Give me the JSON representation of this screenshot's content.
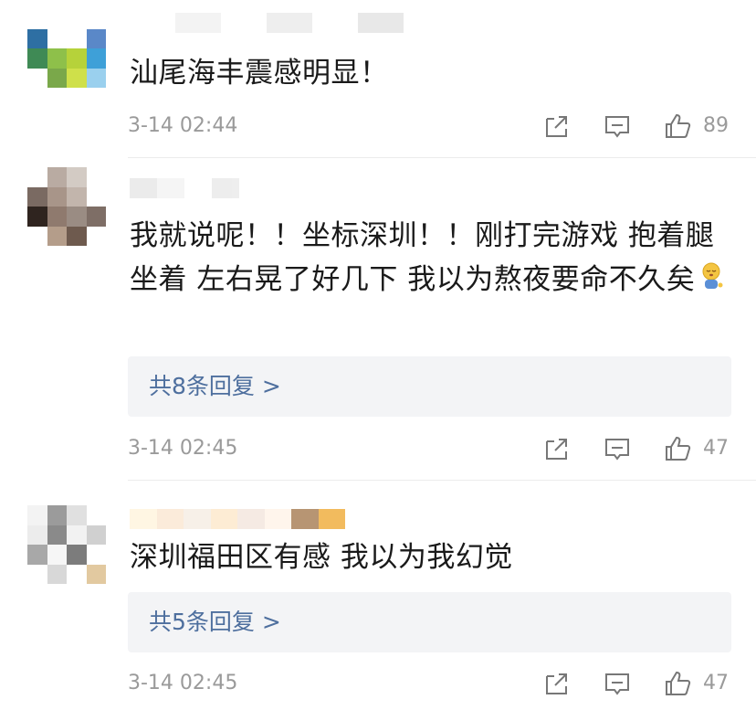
{
  "comments": [
    {
      "text": "汕尾海丰震感明显！",
      "time": "3-14 02:44",
      "likes": "89",
      "avatar_colors": [
        "#ffffff",
        "#ffffff",
        "#ffffff",
        "#ffffff",
        "#2e6fa3",
        "#ffffff",
        "#ffffff",
        "#5a88c8",
        "#3f8a55",
        "#8ec04a",
        "#b6d23a",
        "#3ea0d8",
        "#ffffff",
        "#7aa84a",
        "#cfe04a",
        "#9ad0ee"
      ],
      "username_colors": [
        "#ffffff",
        "#f2f2f2",
        "#ffffff",
        "#ededed",
        "#ffffff",
        "#e6e6e6"
      ]
    },
    {
      "text": "我就说呢！！坐标深圳！！刚打完游戏 抱着腿坐着 左右晃了好几下 我以为熬夜要命不久矣",
      "replies": "共8条回复 >",
      "time": "3-14 02:45",
      "likes": "47",
      "avatar_colors": [
        "#ffffff",
        "#b9aba2",
        "#d3cbc4",
        "#ffffff",
        "#7a6a62",
        "#a89589",
        "#c2b5ac",
        "#ffffff",
        "#2f241f",
        "#8f7a6e",
        "#9a8c83",
        "#7e6e66",
        "#ffffff",
        "#b49d8a",
        "#6e5a4e",
        "#ffffff"
      ],
      "username_colors": [
        "#e9e9e9",
        "#f4f4f4",
        "#ffffff",
        "#ececec"
      ]
    },
    {
      "text": "深圳福田区有感 我以为我幻觉",
      "replies": "共5条回复 >",
      "time": "3-14 02:45",
      "likes": "47",
      "avatar_colors": [
        "#f3f3f3",
        "#9b9b9b",
        "#e0e0e0",
        "#ffffff",
        "#ececec",
        "#8a8a8a",
        "#f2f2f2",
        "#d0d0d0",
        "#a8a8a8",
        "#f6f6f6",
        "#7c7c7c",
        "#ffffff",
        "#ffffff",
        "#d8d8d8",
        "#ffffff",
        "#e2c9a0"
      ],
      "username_colors": [
        "#fff6e0",
        "#fbe9d6",
        "#f7efe6",
        "#fdebd0",
        "#f4e8e0",
        "#fff4ea",
        "#b08a64",
        "#f1b44d"
      ]
    }
  ],
  "icons": {
    "share": "share-icon",
    "reply": "comment-icon",
    "like": "thumbs-up-icon"
  },
  "colors": {
    "link_blue": "#4e6f9e",
    "meta_gray": "#9a9a9a",
    "reply_bg": "#f3f4f6"
  }
}
